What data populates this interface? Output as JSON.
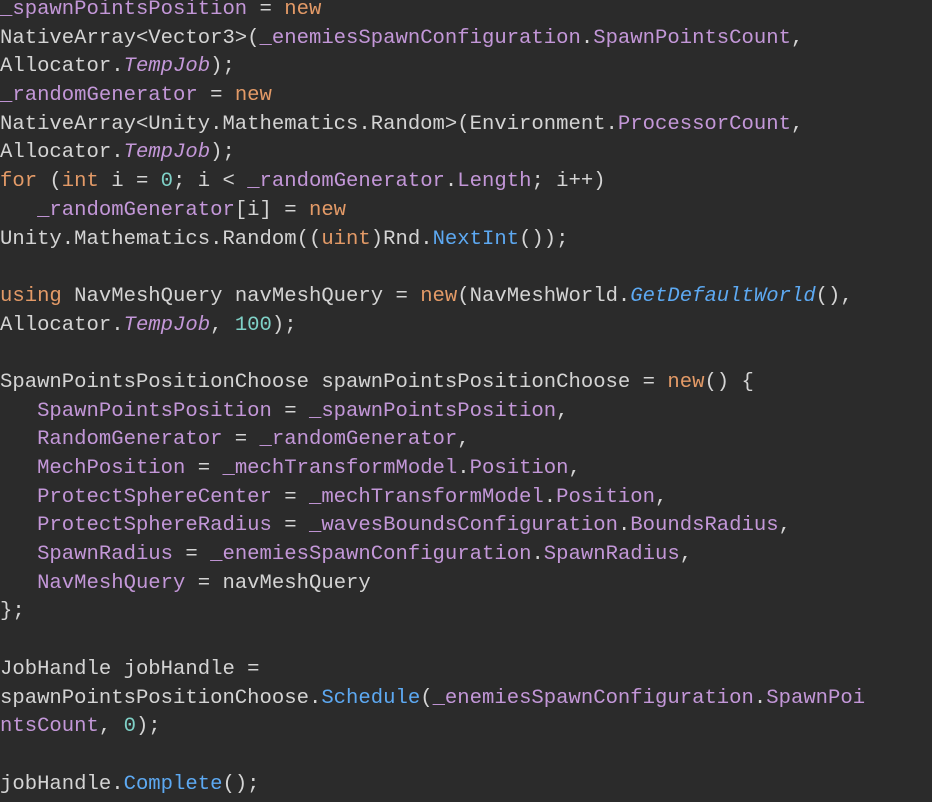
{
  "editor": {
    "background": "#2b2b2b",
    "lines": [
      [
        {
          "t": "_spawnPointsPosition",
          "k": "field"
        },
        {
          "t": " = ",
          "k": "plain"
        },
        {
          "t": "new",
          "k": "keyword"
        }
      ],
      [
        {
          "t": "NativeArray<Vector3>(",
          "k": "plain"
        },
        {
          "t": "_enemiesSpawnConfiguration",
          "k": "field"
        },
        {
          "t": ".",
          "k": "plain"
        },
        {
          "t": "SpawnPointsCount",
          "k": "field"
        },
        {
          "t": ",",
          "k": "plain"
        }
      ],
      [
        {
          "t": "Allocator.",
          "k": "plain"
        },
        {
          "t": "TempJob",
          "k": "italic"
        },
        {
          "t": ");",
          "k": "plain"
        }
      ],
      [
        {
          "t": "_randomGenerator",
          "k": "field"
        },
        {
          "t": " = ",
          "k": "plain"
        },
        {
          "t": "new",
          "k": "keyword"
        }
      ],
      [
        {
          "t": "NativeArray<Unity.Mathematics.Random>(Environment.",
          "k": "plain"
        },
        {
          "t": "ProcessorCount",
          "k": "field"
        },
        {
          "t": ",",
          "k": "plain"
        }
      ],
      [
        {
          "t": "Allocator.",
          "k": "plain"
        },
        {
          "t": "TempJob",
          "k": "italic"
        },
        {
          "t": ");",
          "k": "plain"
        }
      ],
      [
        {
          "t": "for",
          "k": "keyword"
        },
        {
          "t": " (",
          "k": "plain"
        },
        {
          "t": "int",
          "k": "type"
        },
        {
          "t": " i = ",
          "k": "plain"
        },
        {
          "t": "0",
          "k": "number"
        },
        {
          "t": "; i < ",
          "k": "plain"
        },
        {
          "t": "_randomGenerator",
          "k": "field"
        },
        {
          "t": ".",
          "k": "plain"
        },
        {
          "t": "Length",
          "k": "field"
        },
        {
          "t": "; i++)",
          "k": "plain"
        }
      ],
      [
        {
          "t": "   ",
          "k": "plain"
        },
        {
          "t": "_randomGenerator",
          "k": "field"
        },
        {
          "t": "[i] = ",
          "k": "plain"
        },
        {
          "t": "new",
          "k": "keyword"
        }
      ],
      [
        {
          "t": "Unity.Mathematics.Random((",
          "k": "plain"
        },
        {
          "t": "uint",
          "k": "type"
        },
        {
          "t": ")Rnd.",
          "k": "plain"
        },
        {
          "t": "NextInt",
          "k": "method"
        },
        {
          "t": "());",
          "k": "plain"
        }
      ],
      [],
      [
        {
          "t": "using",
          "k": "keyword"
        },
        {
          "t": " NavMeshQuery navMeshQuery = ",
          "k": "plain"
        },
        {
          "t": "new",
          "k": "keyword"
        },
        {
          "t": "(NavMeshWorld.",
          "k": "plain"
        },
        {
          "t": "GetDefaultWorld",
          "k": "method-italic"
        },
        {
          "t": "(),",
          "k": "plain"
        }
      ],
      [
        {
          "t": "Allocator.",
          "k": "plain"
        },
        {
          "t": "TempJob",
          "k": "italic"
        },
        {
          "t": ", ",
          "k": "plain"
        },
        {
          "t": "100",
          "k": "number"
        },
        {
          "t": ");",
          "k": "plain"
        }
      ],
      [],
      [
        {
          "t": "SpawnPointsPositionChoose spawnPointsPositionChoose = ",
          "k": "plain"
        },
        {
          "t": "new",
          "k": "keyword"
        },
        {
          "t": "() {",
          "k": "plain"
        }
      ],
      [
        {
          "t": "   ",
          "k": "plain"
        },
        {
          "t": "SpawnPointsPosition",
          "k": "field"
        },
        {
          "t": " = ",
          "k": "plain"
        },
        {
          "t": "_spawnPointsPosition",
          "k": "field"
        },
        {
          "t": ",",
          "k": "plain"
        }
      ],
      [
        {
          "t": "   ",
          "k": "plain"
        },
        {
          "t": "RandomGenerator",
          "k": "field"
        },
        {
          "t": " = ",
          "k": "plain"
        },
        {
          "t": "_randomGenerator",
          "k": "field"
        },
        {
          "t": ",",
          "k": "plain"
        }
      ],
      [
        {
          "t": "   ",
          "k": "plain"
        },
        {
          "t": "MechPosition",
          "k": "field"
        },
        {
          "t": " = ",
          "k": "plain"
        },
        {
          "t": "_mechTransformModel",
          "k": "field"
        },
        {
          "t": ".",
          "k": "plain"
        },
        {
          "t": "Position",
          "k": "field"
        },
        {
          "t": ",",
          "k": "plain"
        }
      ],
      [
        {
          "t": "   ",
          "k": "plain"
        },
        {
          "t": "ProtectSphereCenter",
          "k": "field"
        },
        {
          "t": " = ",
          "k": "plain"
        },
        {
          "t": "_mechTransformModel",
          "k": "field"
        },
        {
          "t": ".",
          "k": "plain"
        },
        {
          "t": "Position",
          "k": "field"
        },
        {
          "t": ",",
          "k": "plain"
        }
      ],
      [
        {
          "t": "   ",
          "k": "plain"
        },
        {
          "t": "ProtectSphereRadius",
          "k": "field"
        },
        {
          "t": " = ",
          "k": "plain"
        },
        {
          "t": "_wavesBoundsConfiguration",
          "k": "field"
        },
        {
          "t": ".",
          "k": "plain"
        },
        {
          "t": "BoundsRadius",
          "k": "field"
        },
        {
          "t": ",",
          "k": "plain"
        }
      ],
      [
        {
          "t": "   ",
          "k": "plain"
        },
        {
          "t": "SpawnRadius",
          "k": "field"
        },
        {
          "t": " = ",
          "k": "plain"
        },
        {
          "t": "_enemiesSpawnConfiguration",
          "k": "field"
        },
        {
          "t": ".",
          "k": "plain"
        },
        {
          "t": "SpawnRadius",
          "k": "field"
        },
        {
          "t": ",",
          "k": "plain"
        }
      ],
      [
        {
          "t": "   ",
          "k": "plain"
        },
        {
          "t": "NavMeshQuery",
          "k": "field"
        },
        {
          "t": " = navMeshQuery",
          "k": "plain"
        }
      ],
      [
        {
          "t": "};",
          "k": "plain"
        }
      ],
      [],
      [
        {
          "t": "JobHandle jobHandle =",
          "k": "plain"
        }
      ],
      [
        {
          "t": "spawnPointsPositionChoose.",
          "k": "plain"
        },
        {
          "t": "Schedule",
          "k": "method"
        },
        {
          "t": "(",
          "k": "plain"
        },
        {
          "t": "_enemiesSpawnConfiguration",
          "k": "field"
        },
        {
          "t": ".",
          "k": "plain"
        },
        {
          "t": "SpawnPoi",
          "k": "field"
        }
      ],
      [
        {
          "t": "ntsCount",
          "k": "field"
        },
        {
          "t": ", ",
          "k": "plain"
        },
        {
          "t": "0",
          "k": "number"
        },
        {
          "t": ");",
          "k": "plain"
        }
      ],
      [],
      [
        {
          "t": "jobHandle.",
          "k": "plain"
        },
        {
          "t": "Complete",
          "k": "method"
        },
        {
          "t": "();",
          "k": "plain"
        }
      ]
    ]
  }
}
